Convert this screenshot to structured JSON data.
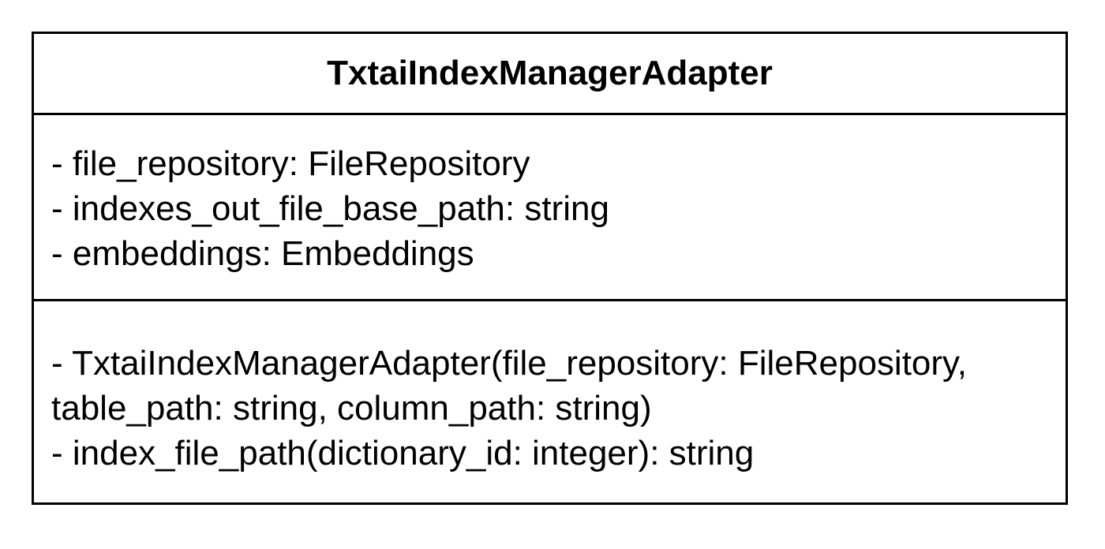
{
  "uml_class": {
    "name": "TxtaiIndexManagerAdapter",
    "attributes": [
      "- file_repository: FileRepository",
      "- indexes_out_file_base_path: string",
      "- embeddings: Embeddings"
    ],
    "methods": [
      "- TxtaiIndexManagerAdapter(file_repository: FileRepository,",
      "table_path: string, column_path: string)",
      "- index_file_path(dictionary_id: integer): string"
    ]
  }
}
